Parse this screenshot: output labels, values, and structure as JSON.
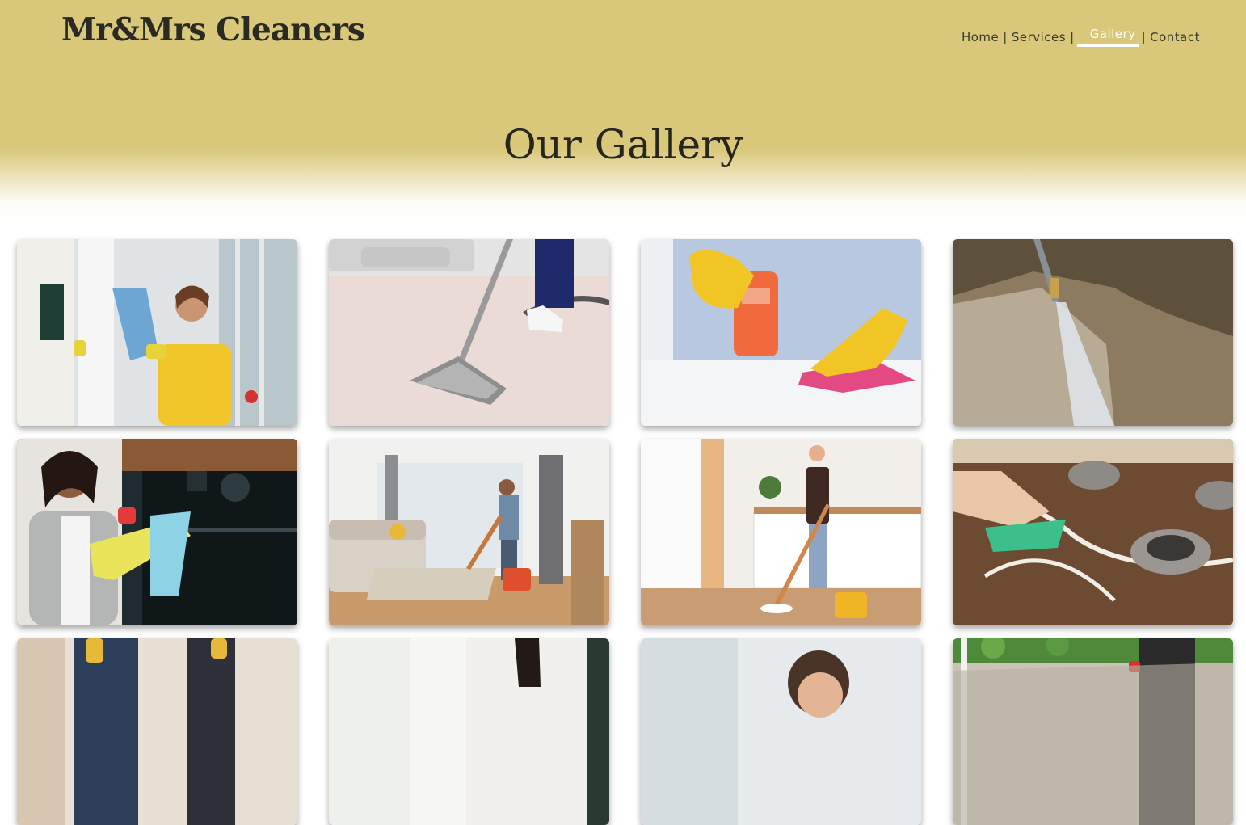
{
  "brand": {
    "name": "Mr&Mrs Cleaners"
  },
  "nav": {
    "items": [
      {
        "label": "Home"
      },
      {
        "label": "Services"
      },
      {
        "label": "Gallery",
        "active": true
      },
      {
        "label": "Contact"
      }
    ],
    "separator": "|"
  },
  "page": {
    "title": "Our Gallery"
  },
  "gallery": {
    "images": [
      {
        "icon": "window-cleaning-photo"
      },
      {
        "icon": "carpet-vacuum-photo"
      },
      {
        "icon": "surface-spray-photo"
      },
      {
        "icon": "pressure-washing-photo"
      },
      {
        "icon": "oven-cleaning-photo"
      },
      {
        "icon": "floor-mopping-livingroom-photo"
      },
      {
        "icon": "kitchen-mopping-photo"
      },
      {
        "icon": "stove-scrubbing-photo"
      },
      {
        "icon": "cleaning-team-photo"
      },
      {
        "icon": "cleaner-portrait-photo"
      },
      {
        "icon": "bathroom-cleaning-photo"
      },
      {
        "icon": "patio-washing-photo"
      }
    ]
  },
  "colors": {
    "hero": "#d9c87a",
    "nav_active": "#ffffff",
    "text_dark": "#26261f"
  }
}
